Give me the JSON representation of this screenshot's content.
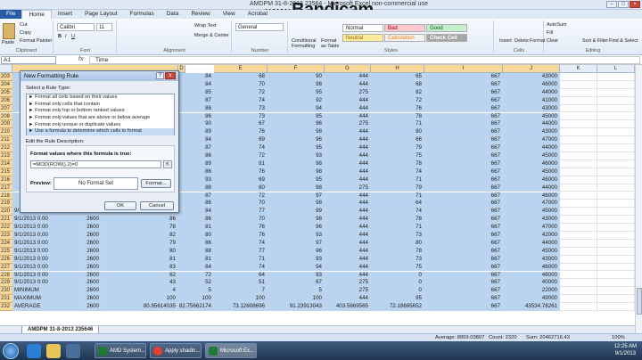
{
  "window": {
    "title": "AMDPM 31-8-2013 23564 - Microsoft Excel non-commercial use",
    "watermark_main": "Bandicam",
    "watermark_prefix": "www."
  },
  "ribbon_tabs": [
    "File",
    "Home",
    "Insert",
    "Page Layout",
    "Formulas",
    "Data",
    "Review",
    "View",
    "Acrobat"
  ],
  "ribbon": {
    "clipboard": {
      "paste": "Paste",
      "cut": "Cut",
      "copy": "Copy",
      "format_painter": "Format Painter",
      "label": "Clipboard"
    },
    "font": {
      "name": "Calibri",
      "size": "11",
      "label": "Font"
    },
    "alignment": {
      "wrap": "Wrap Text",
      "merge": "Merge & Center",
      "label": "Alignment"
    },
    "number": {
      "format": "General",
      "label": "Number"
    },
    "styles": {
      "conditional": "Conditional Formatting",
      "format_table": "Format as Table",
      "normal": "Normal",
      "bad": "Bad",
      "good": "Good",
      "neutral": "Neutral",
      "calculation": "Calculation",
      "check_cell": "Check Cell",
      "label": "Styles"
    },
    "cells": {
      "insert": "Insert",
      "delete": "Delete",
      "format": "Format",
      "label": "Cells"
    },
    "editing": {
      "autosum": "AutoSum",
      "fill": "Fill",
      "clear": "Clear",
      "sort": "Sort & Filter",
      "find": "Find & Select",
      "label": "Editing"
    }
  },
  "formula_bar": {
    "name_box": "A1",
    "fx": "fx",
    "value": "Time"
  },
  "columns": [
    "D",
    "E",
    "F",
    "G",
    "H",
    "I",
    "J",
    "K",
    "L"
  ],
  "rows": [
    {
      "n": "203",
      "a": "",
      "b": "",
      "c": "",
      "d": "84",
      "e": "68",
      "f": "90",
      "g": "444",
      "h": "65",
      "i": "667",
      "j": "43000"
    },
    {
      "n": "204",
      "a": "",
      "b": "",
      "c": "",
      "d": "84",
      "e": "70",
      "f": "98",
      "g": "444",
      "h": "68",
      "i": "667",
      "j": "46000"
    },
    {
      "n": "205",
      "a": "",
      "b": "",
      "c": "",
      "d": "85",
      "e": "72",
      "f": "95",
      "g": "275",
      "h": "82",
      "i": "667",
      "j": "44000"
    },
    {
      "n": "206",
      "a": "",
      "b": "",
      "c": "",
      "d": "87",
      "e": "74",
      "f": "92",
      "g": "444",
      "h": "72",
      "i": "667",
      "j": "41000"
    },
    {
      "n": "207",
      "a": "",
      "b": "",
      "c": "",
      "d": "86",
      "e": "73",
      "f": "94",
      "g": "444",
      "h": "76",
      "i": "667",
      "j": "43000"
    },
    {
      "n": "208",
      "a": "",
      "b": "",
      "c": "",
      "d": "86",
      "e": "73",
      "f": "95",
      "g": "444",
      "h": "78",
      "i": "667",
      "j": "45000"
    },
    {
      "n": "209",
      "a": "",
      "b": "",
      "c": "",
      "d": "90",
      "e": "67",
      "f": "96",
      "g": "275",
      "h": "71",
      "i": "667",
      "j": "44000"
    },
    {
      "n": "210",
      "a": "",
      "b": "",
      "c": "",
      "d": "89",
      "e": "76",
      "f": "98",
      "g": "444",
      "h": "80",
      "i": "667",
      "j": "43000"
    },
    {
      "n": "211",
      "a": "",
      "b": "",
      "c": "",
      "d": "84",
      "e": "69",
      "f": "96",
      "g": "444",
      "h": "66",
      "i": "667",
      "j": "47000"
    },
    {
      "n": "212",
      "a": "",
      "b": "",
      "c": "",
      "d": "87",
      "e": "74",
      "f": "95",
      "g": "444",
      "h": "79",
      "i": "667",
      "j": "44000"
    },
    {
      "n": "213",
      "a": "",
      "b": "",
      "c": "",
      "d": "86",
      "e": "72",
      "f": "93",
      "g": "444",
      "h": "75",
      "i": "667",
      "j": "45000"
    },
    {
      "n": "214",
      "a": "",
      "b": "",
      "c": "",
      "d": "89",
      "e": "81",
      "f": "98",
      "g": "444",
      "h": "78",
      "i": "667",
      "j": "46000"
    },
    {
      "n": "215",
      "a": "",
      "b": "",
      "c": "",
      "d": "86",
      "e": "76",
      "f": "98",
      "g": "444",
      "h": "74",
      "i": "667",
      "j": "45000"
    },
    {
      "n": "216",
      "a": "",
      "b": "",
      "c": "",
      "d": "93",
      "e": "69",
      "f": "95",
      "g": "444",
      "h": "71",
      "i": "667",
      "j": "46000"
    },
    {
      "n": "217",
      "a": "",
      "b": "",
      "c": "",
      "d": "88",
      "e": "80",
      "f": "98",
      "g": "275",
      "h": "79",
      "i": "667",
      "j": "44000"
    },
    {
      "n": "218",
      "a": "",
      "b": "",
      "c": "",
      "d": "87",
      "e": "72",
      "f": "97",
      "g": "444",
      "h": "71",
      "i": "667",
      "j": "46000"
    },
    {
      "n": "219",
      "a": "",
      "b": "",
      "c": "",
      "d": "86",
      "e": "70",
      "f": "98",
      "g": "444",
      "h": "64",
      "i": "667",
      "j": "47000"
    },
    {
      "n": "220",
      "a": "9/1/2013 0:00",
      "b": "2600",
      "c": "81",
      "d": "84",
      "e": "77",
      "f": "99",
      "g": "444",
      "h": "74",
      "i": "667",
      "j": "45000"
    },
    {
      "n": "221",
      "a": "9/1/2013 0:00",
      "b": "2600",
      "c": "86",
      "d": "86",
      "e": "70",
      "f": "98",
      "g": "444",
      "h": "78",
      "i": "667",
      "j": "43000"
    },
    {
      "n": "222",
      "a": "9/1/2013 0:00",
      "b": "2600",
      "c": "78",
      "d": "81",
      "e": "76",
      "f": "96",
      "g": "444",
      "h": "71",
      "i": "667",
      "j": "47000"
    },
    {
      "n": "223",
      "a": "9/1/2013 0:00",
      "b": "2600",
      "c": "82",
      "d": "80",
      "e": "76",
      "f": "93",
      "g": "444",
      "h": "73",
      "i": "667",
      "j": "42000"
    },
    {
      "n": "224",
      "a": "9/1/2013 0:00",
      "b": "2600",
      "c": "79",
      "d": "86",
      "e": "74",
      "f": "97",
      "g": "444",
      "h": "80",
      "i": "667",
      "j": "44000"
    },
    {
      "n": "225",
      "a": "9/1/2013 0:00",
      "b": "2600",
      "c": "80",
      "d": "88",
      "e": "77",
      "f": "96",
      "g": "444",
      "h": "78",
      "i": "667",
      "j": "45000"
    },
    {
      "n": "226",
      "a": "9/1/2013 0:00",
      "b": "2600",
      "c": "81",
      "d": "81",
      "e": "71",
      "f": "93",
      "g": "444",
      "h": "73",
      "i": "667",
      "j": "43000"
    },
    {
      "n": "227",
      "a": "9/1/2013 0:00",
      "b": "2600",
      "c": "83",
      "d": "84",
      "e": "74",
      "f": "94",
      "g": "444",
      "h": "75",
      "i": "667",
      "j": "46000"
    },
    {
      "n": "228",
      "a": "9/1/2013 0:00",
      "b": "2600",
      "c": "62",
      "d": "72",
      "e": "64",
      "f": "93",
      "g": "444",
      "h": "0",
      "i": "667",
      "j": "46000"
    },
    {
      "n": "229",
      "a": "9/1/2013 0:00",
      "b": "2600",
      "c": "43",
      "d": "52",
      "e": "51",
      "f": "67",
      "g": "275",
      "h": "0",
      "i": "667",
      "j": "40000"
    },
    {
      "n": "230",
      "a": "MINIMUM",
      "b": "2600",
      "c": "4",
      "d": "5",
      "e": "7",
      "f": "5",
      "g": "275",
      "h": "0",
      "i": "667",
      "j": "22000"
    },
    {
      "n": "231",
      "a": "MAXIMUM",
      "b": "2600",
      "c": "100",
      "d": "100",
      "e": "100",
      "f": "100",
      "g": "444",
      "h": "95",
      "i": "667",
      "j": "49000"
    },
    {
      "n": "232",
      "a": "AVERAGE",
      "b": "2600",
      "c": "80.95614035",
      "d": "82.75662174",
      "e": "73.12608696",
      "f": "91.23913043",
      "g": "403.5869565",
      "h": "72.18695652",
      "i": "667",
      "j": "43534.78261"
    }
  ],
  "sheet_tab": "AMDPM 31-8-2013 235646",
  "status": {
    "average": "Average: 8959.03807",
    "count": "Count: 2320",
    "sum": "Sum: 20462716.43",
    "zoom": "100%"
  },
  "dialog": {
    "title": "New Formatting Rule",
    "help": "?",
    "close": "x",
    "select_label": "Select a Rule Type:",
    "rule_types": [
      "► Format all cells based on their values",
      "► Format only cells that contain",
      "► Format only top or bottom ranked values",
      "► Format only values that are above or below average",
      "► Format only unique or duplicate values",
      "► Use a formula to determine which cells to format"
    ],
    "edit_label": "Edit the Rule Description:",
    "formula_label": "Format values where this formula is true:",
    "formula": "=MOD(ROW(),2)=0",
    "preview_label": "Preview:",
    "preview_text": "No Format Set",
    "format_button": "Format...",
    "ok": "OK",
    "cancel": "Cancel"
  },
  "taskbar": {
    "items": [
      "AMD System...",
      "Apply shadin...",
      "Microsoft Ex..."
    ],
    "time": "12:25 AM",
    "date": "9/1/2013"
  },
  "colors": {
    "selection": "#b8d4f0",
    "accent": "#2a5ba6",
    "row_header_selected": "#f9d99a"
  }
}
